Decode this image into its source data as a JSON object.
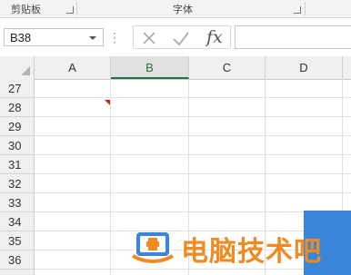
{
  "ribbon": {
    "groups": [
      {
        "label": "剪贴板",
        "icon": "dialog-launcher-icon"
      },
      {
        "label": "字体",
        "icon": "dialog-launcher-icon"
      }
    ]
  },
  "formula_bar": {
    "name_box_value": "B38",
    "cancel_icon": "close-icon",
    "enter_icon": "checkmark-icon",
    "function_label": "fx",
    "formula_value": ""
  },
  "sheet": {
    "columns": [
      "A",
      "B",
      "C",
      "D"
    ],
    "selected_column": "B",
    "rows": [
      "27",
      "28",
      "29",
      "30",
      "31",
      "32",
      "33",
      "34",
      "35",
      "36"
    ],
    "comment_indicator_color": "#d02020"
  },
  "watermark": {
    "text": "电脑技术吧",
    "colors": {
      "orange": "#f08a22",
      "blue": "#3b86d8"
    }
  },
  "colors": {
    "accent": "#217346"
  }
}
